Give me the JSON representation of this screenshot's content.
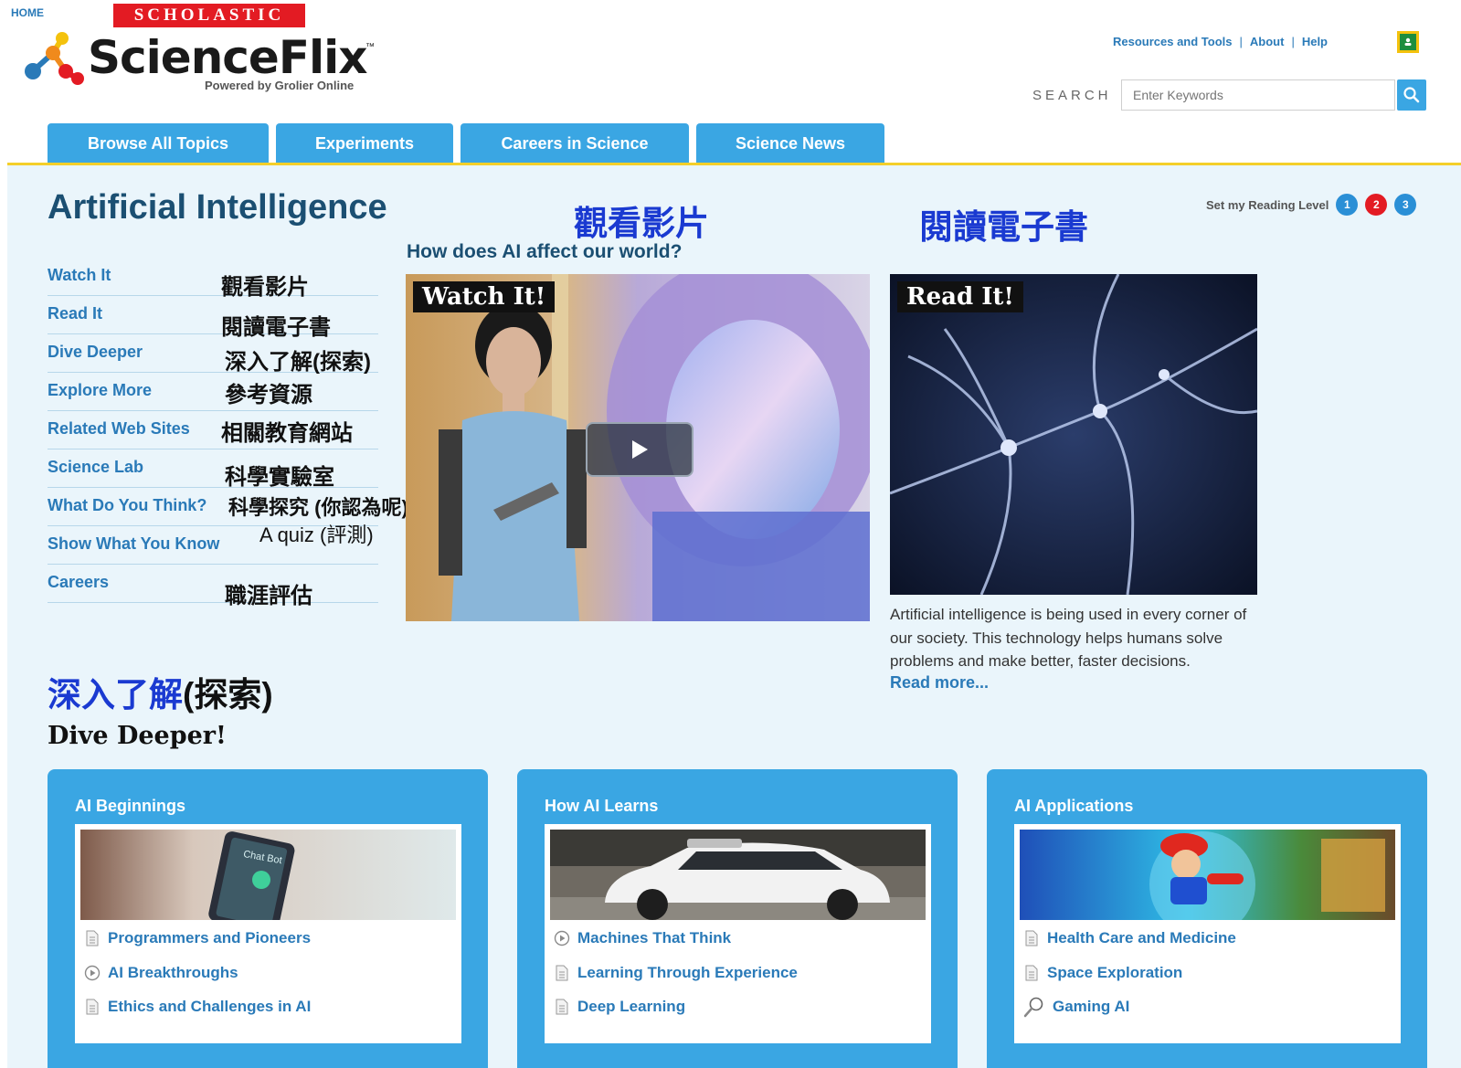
{
  "header": {
    "home": "HOME",
    "scholastic": "SCHOLASTIC",
    "logo": "ScienceFlix",
    "trademark": "™",
    "logo_sub": "Powered by Grolier Online",
    "links": [
      "Resources and Tools",
      "About",
      "Help"
    ],
    "separator": "|",
    "search_label": "SEARCH",
    "search_placeholder": "Enter Keywords"
  },
  "nav": {
    "tabs": [
      "Browse All Topics",
      "Experiments",
      "Careers in Science",
      "Science News"
    ]
  },
  "page": {
    "title": "Artificial Intelligence",
    "reading_level_label": "Set my Reading Level",
    "levels": [
      "1",
      "2",
      "3"
    ],
    "level_colors": [
      "#2a8fd6",
      "#e31b23",
      "#2a8fd6"
    ],
    "video_question": "How does AI affect our world?",
    "annotations": {
      "watch": "觀看影片",
      "read": "閱讀電子書",
      "dive_blue": "深入了解",
      "dive_black": "(探索)"
    }
  },
  "sidebar": {
    "items": [
      {
        "en": "Watch It",
        "zh": "觀看影片"
      },
      {
        "en": "Read It",
        "zh": "閱讀電子書"
      },
      {
        "en": "Dive Deeper",
        "zh": "深入了解(探索)"
      },
      {
        "en": "Explore More",
        "zh": "參考資源"
      },
      {
        "en": "Related Web Sites",
        "zh": "相關教育網站"
      },
      {
        "en": "Science Lab",
        "zh": "科學實驗室"
      },
      {
        "en": "What Do You Think?",
        "zh": "科學探究 (你認為呢)"
      },
      {
        "en": "Show What You Know",
        "zh": "A quiz (評測)"
      },
      {
        "en": "Careers",
        "zh": "職涯評估"
      }
    ]
  },
  "media": {
    "watch_badge": "Watch It!",
    "read_badge": "Read It!",
    "read_description": "Artificial intelligence is being used in every corner of our society. This technology helps humans solve problems and make better, faster decisions.",
    "read_more": "Read more..."
  },
  "dive": {
    "heading": "Dive Deeper!",
    "cards": [
      {
        "title": "AI Beginnings",
        "image_caption": "Chat Bot",
        "links": [
          {
            "label": "Programmers and Pioneers",
            "icon": "document-icon"
          },
          {
            "label": "AI Breakthroughs",
            "icon": "play-circle-icon"
          },
          {
            "label": "Ethics and Challenges in AI",
            "icon": "document-icon"
          }
        ]
      },
      {
        "title": "How AI Learns",
        "links": [
          {
            "label": "Machines That Think",
            "icon": "play-circle-icon"
          },
          {
            "label": "Learning Through Experience",
            "icon": "document-icon"
          },
          {
            "label": "Deep Learning",
            "icon": "document-icon"
          }
        ]
      },
      {
        "title": "AI Applications",
        "links": [
          {
            "label": "Health Care and Medicine",
            "icon": "document-icon"
          },
          {
            "label": "Space Exploration",
            "icon": "document-icon"
          },
          {
            "label": "Gaming AI",
            "icon": "magnifier-icon"
          }
        ]
      }
    ]
  }
}
